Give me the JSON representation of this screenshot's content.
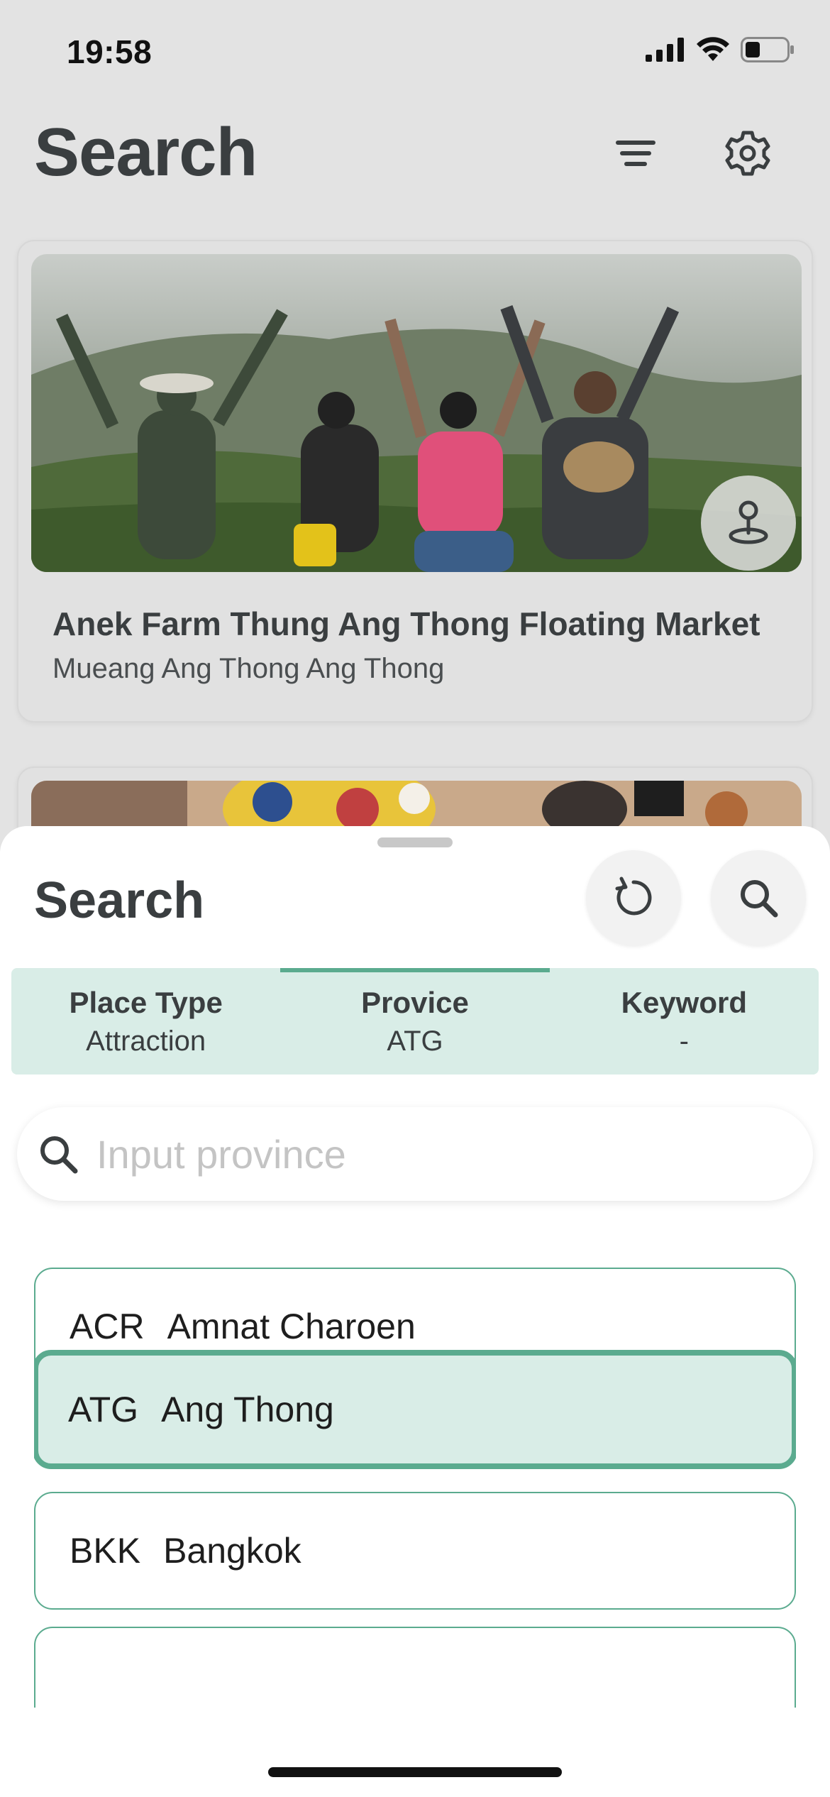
{
  "status": {
    "time": "19:58"
  },
  "header": {
    "title": "Search"
  },
  "cards": [
    {
      "title": "Anek Farm Thung Ang Thong Floating Market",
      "subtitle": "Mueang Ang Thong Ang Thong"
    }
  ],
  "sheet": {
    "title": "Search",
    "tabs": [
      {
        "label": "Place Type",
        "value": "Attraction",
        "active": false
      },
      {
        "label": "Provice",
        "value": "ATG",
        "active": true
      },
      {
        "label": "Keyword",
        "value": "-",
        "active": false
      }
    ],
    "search": {
      "placeholder": "Input province",
      "value": ""
    },
    "provinces": [
      {
        "code": "ACR",
        "name": "Amnat Charoen",
        "selected": false
      },
      {
        "code": "ATG",
        "name": "Ang Thong",
        "selected": true
      },
      {
        "code": "BKK",
        "name": "Bangkok",
        "selected": false
      },
      {
        "code": "",
        "name": "",
        "selected": false
      }
    ]
  },
  "colors": {
    "accent": "#5bab8f",
    "accent_light": "#d9ede7",
    "text_dark": "#3a3e40"
  },
  "icons": [
    "filter-icon",
    "gear-icon",
    "map-pin-icon",
    "reset-icon",
    "search-icon"
  ]
}
